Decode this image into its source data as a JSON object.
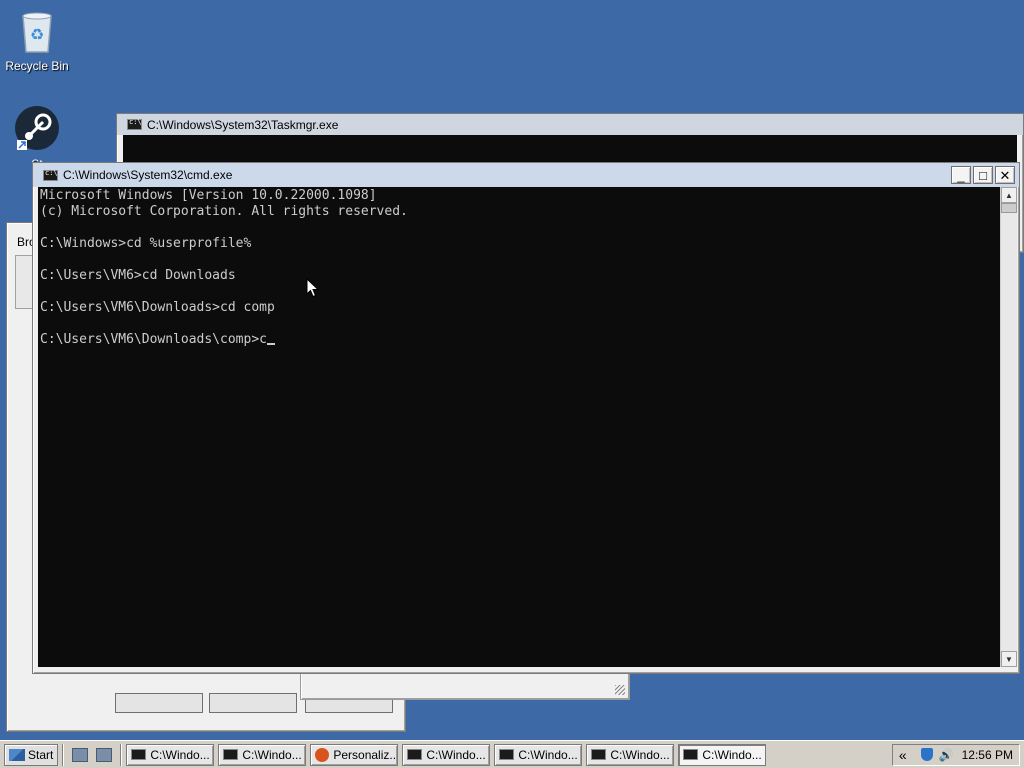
{
  "desktop": {
    "icons": [
      {
        "label": "Recycle Bin"
      },
      {
        "label": "St"
      }
    ]
  },
  "taskmgr_window": {
    "title": "C:\\Windows\\System32\\Taskmgr.exe"
  },
  "browse_dialog": {
    "title": "Bro"
  },
  "cmd_window": {
    "title": "C:\\Windows\\System32\\cmd.exe",
    "buttons": {
      "minimize": "_",
      "maximize": "□",
      "close": "✕"
    },
    "lines": [
      "Microsoft Windows [Version 10.0.22000.1098]",
      "(c) Microsoft Corporation. All rights reserved.",
      "",
      "C:\\Windows>cd %userprofile%",
      "",
      "C:\\Users\\VM6>cd Downloads",
      "",
      "C:\\Users\\VM6\\Downloads>cd comp",
      "",
      "C:\\Users\\VM6\\Downloads\\comp>c"
    ]
  },
  "taskbar": {
    "start_label": "Start",
    "tasks": [
      {
        "label": "C:\\Windo..."
      },
      {
        "label": "C:\\Windo..."
      },
      {
        "label": "Personaliz..."
      },
      {
        "label": "C:\\Windo..."
      },
      {
        "label": "C:\\Windo..."
      },
      {
        "label": "C:\\Windo..."
      },
      {
        "label": "C:\\Windo..."
      }
    ],
    "tray": {
      "chevron": "«",
      "clock": "12:56 PM"
    }
  },
  "colors": {
    "desktop": "#3d6aa7",
    "console_bg": "#0c0c0c",
    "console_fg": "#cccccc"
  }
}
